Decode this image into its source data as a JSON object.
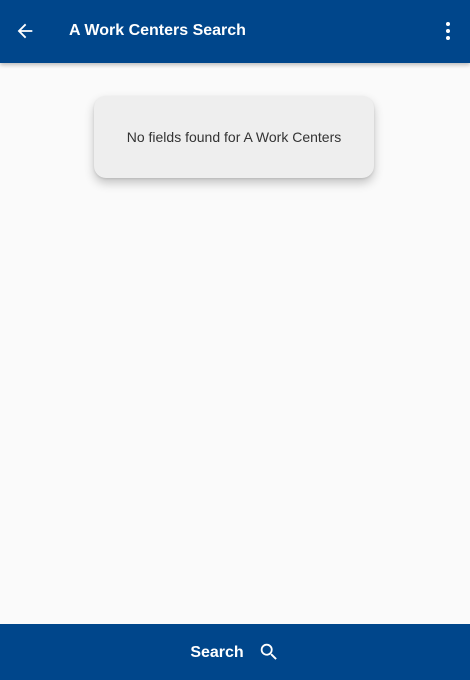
{
  "header": {
    "title": "A Work Centers Search",
    "background": "#00468b",
    "back_icon": "arrow-left-icon",
    "menu_icon": "more-vertical-icon"
  },
  "main": {
    "empty_message": "No fields found for A Work Centers"
  },
  "footer": {
    "search_label": "Search",
    "search_icon": "search-icon",
    "background": "#00468b"
  }
}
